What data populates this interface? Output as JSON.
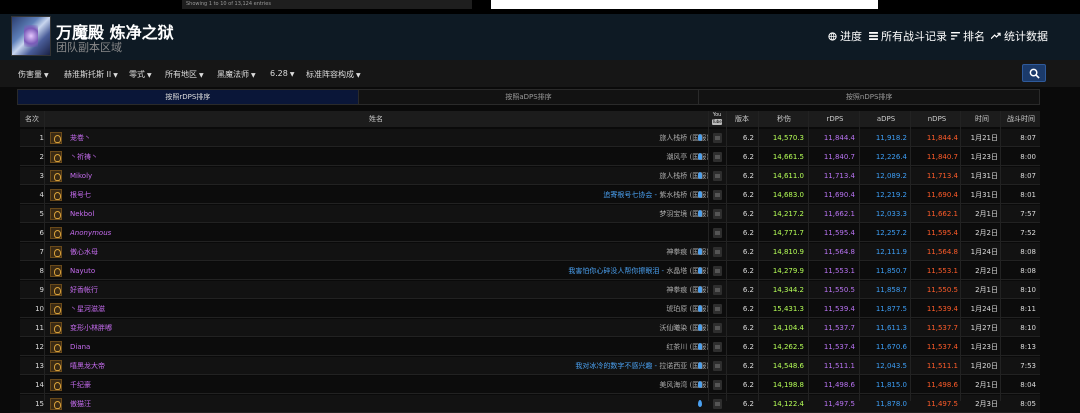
{
  "top_strip": {
    "text": "Showing 1 to 10 of 13,124 entries"
  },
  "header": {
    "title": "万魔殿 炼净之狱",
    "subtitle": "团队副本区域",
    "nav": [
      {
        "label": "进度",
        "icon": "globe-icon"
      },
      {
        "label": "所有战斗记录",
        "icon": "list-icon"
      },
      {
        "label": "排名",
        "icon": "ranking-icon"
      },
      {
        "label": "统计数据",
        "icon": "trend-icon"
      }
    ]
  },
  "filters": [
    {
      "label": "伤害量"
    },
    {
      "label": "赫淮斯托斯 II"
    },
    {
      "label": "零式"
    },
    {
      "label": "所有地区"
    },
    {
      "label": "黑魔法师"
    },
    {
      "label": "6.28"
    },
    {
      "label": "标准阵容构成"
    }
  ],
  "tabs": [
    {
      "label": "按照rDPS排序",
      "active": true
    },
    {
      "label": "按照aDPS排序",
      "active": false
    },
    {
      "label": "按照nDPS排序",
      "active": false
    }
  ],
  "columns": {
    "rank": "名次",
    "name": "姓名",
    "yt_top": "You",
    "yt_bottom": "Tube",
    "version": "版本",
    "dps": "秒伤",
    "rdps": "rDPS",
    "adps": "aDPS",
    "ndps": "nDPS",
    "date": "时间",
    "duration": "战斗时间"
  },
  "accent_colors": {
    "name": "#c66cf0",
    "dps": "#b5ff57",
    "rdps": "#b873f2",
    "adps": "#3d9ef5",
    "ndps": "#ff5c2a",
    "guild": "#4aa0f0"
  },
  "rows": [
    {
      "rank": "1",
      "name": "茏卷丶",
      "guild": "",
      "server": "旅人栈桥 (国服)",
      "drop": true,
      "version": "6.2",
      "dps": "14,570.3",
      "rdps": "11,844.4",
      "adps": "11,918.2",
      "ndps": "11,844.4",
      "date": "1月21日",
      "duration": "8:07"
    },
    {
      "rank": "2",
      "name": "丶祈祷丶",
      "guild": "",
      "server": "潮风亭 (国服)",
      "drop": true,
      "version": "6.2",
      "dps": "14,661.5",
      "rdps": "11,840.7",
      "adps": "12,226.4",
      "ndps": "11,840.7",
      "date": "1月23日",
      "duration": "8:00"
    },
    {
      "rank": "3",
      "name": "Mikoly",
      "guild": "",
      "server": "旅人栈桥 (国服)",
      "drop": true,
      "version": "6.2",
      "dps": "14,611.0",
      "rdps": "11,713.4",
      "adps": "12,089.2",
      "ndps": "11,713.4",
      "date": "1月31日",
      "duration": "8:07"
    },
    {
      "rank": "4",
      "name": "根号七",
      "guild": "追寄根号七协会 - ",
      "server": "紫水栈桥 (国服)",
      "drop": true,
      "version": "6.2",
      "dps": "14,683.0",
      "rdps": "11,690.4",
      "adps": "12,219.2",
      "ndps": "11,690.4",
      "date": "1月31日",
      "duration": "8:01"
    },
    {
      "rank": "5",
      "name": "Nekbol",
      "guild": "",
      "server": "梦羽宝境 (国服)",
      "drop": true,
      "version": "6.2",
      "dps": "14,217.2",
      "rdps": "11,662.1",
      "adps": "12,033.3",
      "ndps": "11,662.1",
      "date": "2月1日",
      "duration": "7:57"
    },
    {
      "rank": "6",
      "name": "Anonymous",
      "anon": true,
      "guild": "",
      "server": "",
      "drop": false,
      "version": "6.2",
      "dps": "14,771.7",
      "rdps": "11,595.4",
      "adps": "12,257.2",
      "ndps": "11,595.4",
      "date": "2月2日",
      "duration": "7:52"
    },
    {
      "rank": "7",
      "name": "傲心水母",
      "guild": "",
      "server": "神拳痕 (国服)",
      "drop": true,
      "version": "6.2",
      "dps": "14,810.9",
      "rdps": "11,564.8",
      "adps": "12,111.9",
      "ndps": "11,564.8",
      "date": "1月24日",
      "duration": "8:08"
    },
    {
      "rank": "8",
      "name": "Nayuto",
      "guild": "我害怕你心碎没人帮你擦眼泪 - ",
      "server": "水晶塔 (国服)",
      "drop": true,
      "version": "6.2",
      "dps": "14,279.9",
      "rdps": "11,553.1",
      "adps": "11,850.7",
      "ndps": "11,553.1",
      "date": "2月2日",
      "duration": "8:08"
    },
    {
      "rank": "9",
      "name": "好香帐行",
      "guild": "",
      "server": "神拳痕 (国服)",
      "drop": true,
      "version": "6.2",
      "dps": "14,344.2",
      "rdps": "11,550.5",
      "adps": "11,858.7",
      "ndps": "11,550.5",
      "date": "2月1日",
      "duration": "8:10"
    },
    {
      "rank": "10",
      "name": "丶星河滋滋",
      "guild": "",
      "server": "琥珀原 (国服)",
      "drop": true,
      "version": "6.2",
      "dps": "15,431.3",
      "rdps": "11,539.4",
      "adps": "11,877.5",
      "ndps": "11,539.4",
      "date": "1月24日",
      "duration": "8:11"
    },
    {
      "rank": "11",
      "name": "变形小林胖嘟",
      "guild": "",
      "server": "沃仙曦染 (国服)",
      "drop": true,
      "version": "6.2",
      "dps": "14,104.4",
      "rdps": "11,537.7",
      "adps": "11,611.3",
      "ndps": "11,537.7",
      "date": "1月27日",
      "duration": "8:10"
    },
    {
      "rank": "12",
      "name": "Diana",
      "guild": "",
      "server": "红茶川 (国服)",
      "drop": true,
      "version": "6.2",
      "dps": "14,262.5",
      "rdps": "11,537.4",
      "adps": "11,670.6",
      "ndps": "11,537.4",
      "date": "1月23日",
      "duration": "8:13"
    },
    {
      "rank": "13",
      "name": "嘻黑龙大帝",
      "guild": "我对冰冷的数字不感兴趣 - ",
      "server": "拉诺西亚 (国服)",
      "drop": true,
      "version": "6.2",
      "dps": "14,548.6",
      "rdps": "11,511.1",
      "adps": "12,043.5",
      "ndps": "11,511.1",
      "date": "1月20日",
      "duration": "7:53"
    },
    {
      "rank": "14",
      "name": "千纪豪",
      "guild": "",
      "server": "美风海湾 (国服)",
      "drop": true,
      "version": "6.2",
      "dps": "14,198.8",
      "rdps": "11,498.6",
      "adps": "11,815.0",
      "ndps": "11,498.6",
      "date": "2月1日",
      "duration": "8:04"
    },
    {
      "rank": "15",
      "name": "傲猫汪",
      "guild": "",
      "server": "",
      "drop": true,
      "version": "6.2",
      "dps": "14,122.4",
      "rdps": "11,497.5",
      "adps": "11,878.0",
      "ndps": "11,497.5",
      "date": "2月3日",
      "duration": "8:05"
    }
  ]
}
